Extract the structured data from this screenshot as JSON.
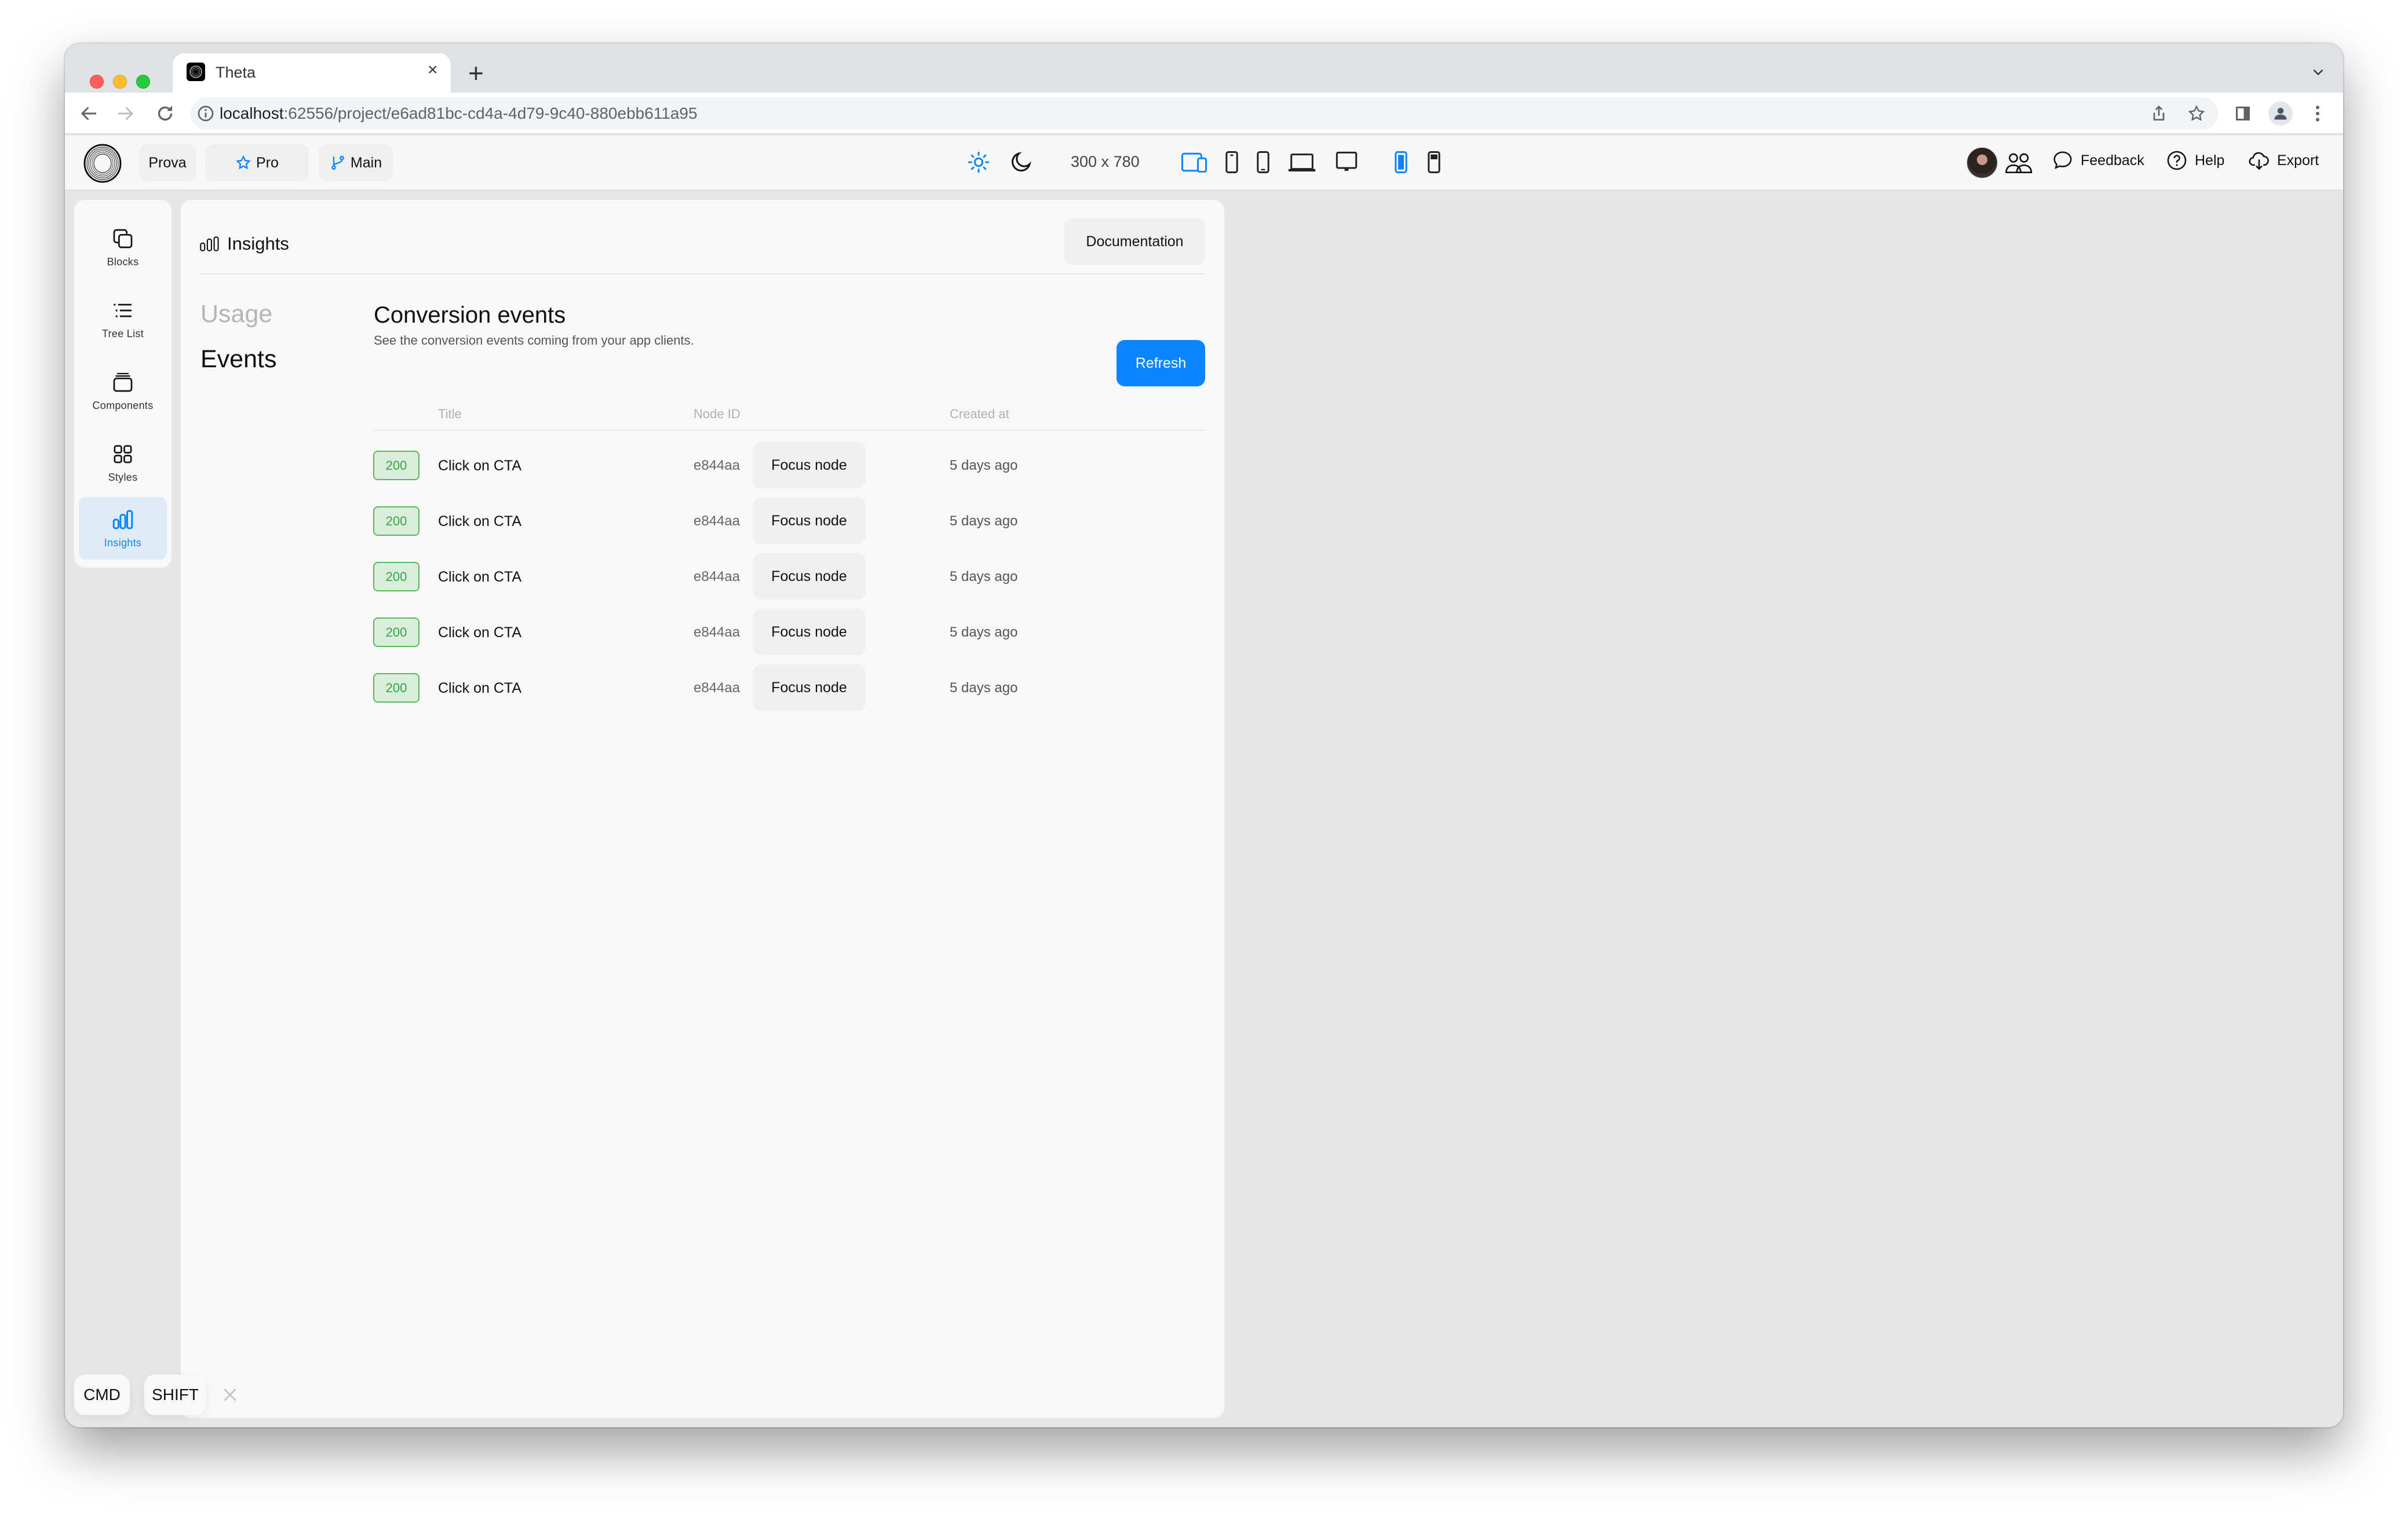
{
  "browser": {
    "tab": {
      "title": "Theta",
      "close_glyph": "×"
    },
    "new_tab_glyph": "+",
    "url": {
      "host": "localhost",
      "rest": ":62556/project/e6ad81bc-cd4a-4d79-9c40-880ebb611a95"
    },
    "icons": [
      "back-arrow-icon",
      "forward-arrow-icon",
      "reload-icon",
      "info-icon",
      "share-icon",
      "bookmark-star-icon",
      "side-panel-icon",
      "profile-icon",
      "kebab-menu-icon",
      "tab-list-chevron-icon"
    ]
  },
  "toolbar": {
    "project_button": "Prova",
    "plan_button": "Pro",
    "branch_button": "Main",
    "viewport_size": "300 x 780",
    "feedback_label": "Feedback",
    "help_label": "Help",
    "export_label": "Export",
    "accent_color": "#0A84FF",
    "device_icons": [
      "tablet-phone-icon",
      "phone-icon",
      "phone-outline-icon",
      "laptop-icon",
      "desktop-icon",
      "phone-fill-icon",
      "phone-notch-icon"
    ]
  },
  "sidebar": {
    "items": [
      {
        "label": "Blocks",
        "icon": "blocks-icon",
        "active": false
      },
      {
        "label": "Tree List",
        "icon": "tree-list-icon",
        "active": false
      },
      {
        "label": "Components",
        "icon": "components-icon",
        "active": false
      },
      {
        "label": "Styles",
        "icon": "styles-icon",
        "active": false
      },
      {
        "label": "Insights",
        "icon": "insights-icon",
        "active": true
      }
    ]
  },
  "panel": {
    "title": "Insights",
    "documentation_button": "Documentation",
    "subnav": [
      {
        "label": "Usage",
        "active": false
      },
      {
        "label": "Events",
        "active": true
      }
    ],
    "section": {
      "title": "Conversion events",
      "subtitle": "See the conversion events coming from your app clients.",
      "refresh_button": "Refresh"
    },
    "table": {
      "columns": [
        "Title",
        "Node ID",
        "Created at"
      ],
      "rows": [
        {
          "status": "200",
          "title": "Click on CTA",
          "node_id": "e844aa",
          "action": "Focus node",
          "created_at": "5 days ago"
        },
        {
          "status": "200",
          "title": "Click on CTA",
          "node_id": "e844aa",
          "action": "Focus node",
          "created_at": "5 days ago"
        },
        {
          "status": "200",
          "title": "Click on CTA",
          "node_id": "e844aa",
          "action": "Focus node",
          "created_at": "5 days ago"
        },
        {
          "status": "200",
          "title": "Click on CTA",
          "node_id": "e844aa",
          "action": "Focus node",
          "created_at": "5 days ago"
        },
        {
          "status": "200",
          "title": "Click on CTA",
          "node_id": "e844aa",
          "action": "Focus node",
          "created_at": "5 days ago"
        }
      ]
    }
  },
  "key_hints": {
    "keys": [
      "CMD",
      "SHIFT"
    ],
    "close_glyph": "×"
  }
}
